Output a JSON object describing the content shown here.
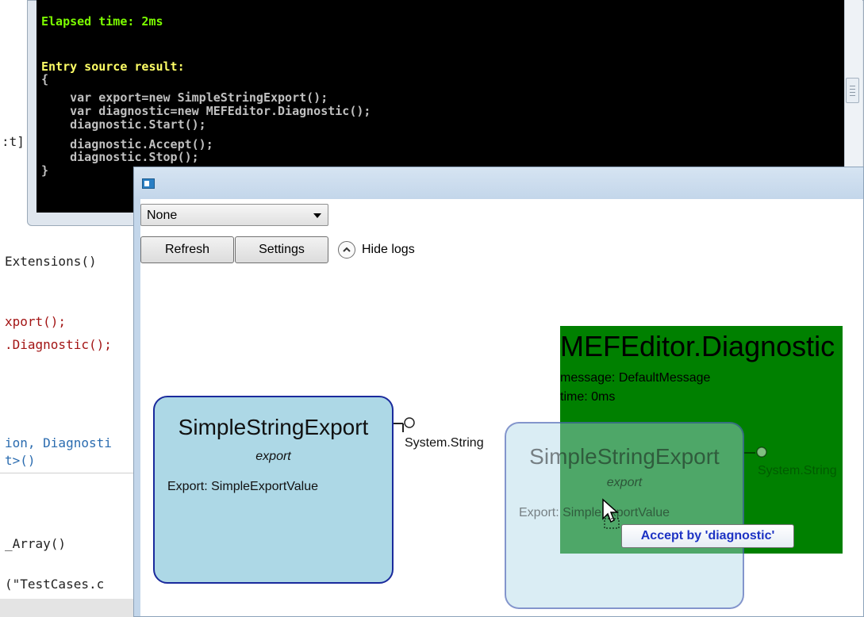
{
  "editor": {
    "lines": [
      {
        "text": ":t]"
      },
      {
        "text": "Extensions()"
      },
      {
        "text": "xport();"
      },
      {
        "text": ".Diagnostic();"
      },
      {
        "text": "ion, Diagnosti"
      },
      {
        "text": "t>()"
      },
      {
        "text": "_Array()"
      },
      {
        "text": "(\"TestCases.c"
      }
    ]
  },
  "console": {
    "elapsed": "Elapsed time: 2ms",
    "result_heading": "Entry source result:",
    "lines": [
      "{",
      "    var export=new SimpleStringExport();",
      "    var diagnostic=new MEFEditor.Diagnostic();",
      "    diagnostic.Start();",
      "    diagnostic.Accept();",
      "    diagnostic.Stop();",
      "}"
    ]
  },
  "toolbar": {
    "dropdown_value": "None",
    "refresh_label": "Refresh",
    "settings_label": "Settings",
    "hide_logs_label": "Hide logs"
  },
  "diagram": {
    "component": {
      "title": "SimpleStringExport",
      "kind": "export",
      "export_text": "Export: SimpleExportValue",
      "port_label": "System.String"
    },
    "dragged": {
      "title": "SimpleStringExport",
      "kind": "export",
      "export_text": "Export: SimpleExportValue",
      "port_label": "System.String"
    },
    "diagnostic": {
      "title": "MEFEditor.Diagnostic",
      "message": "message: DefaultMessage",
      "time": "time: 0ms"
    },
    "tooltip": "Accept by 'diagnostic'"
  },
  "colors": {
    "component_fill": "#add8e6",
    "component_border": "#1a2a9c",
    "diagnostic_fill": "#008000",
    "tooltip_text": "#1d33c4"
  }
}
